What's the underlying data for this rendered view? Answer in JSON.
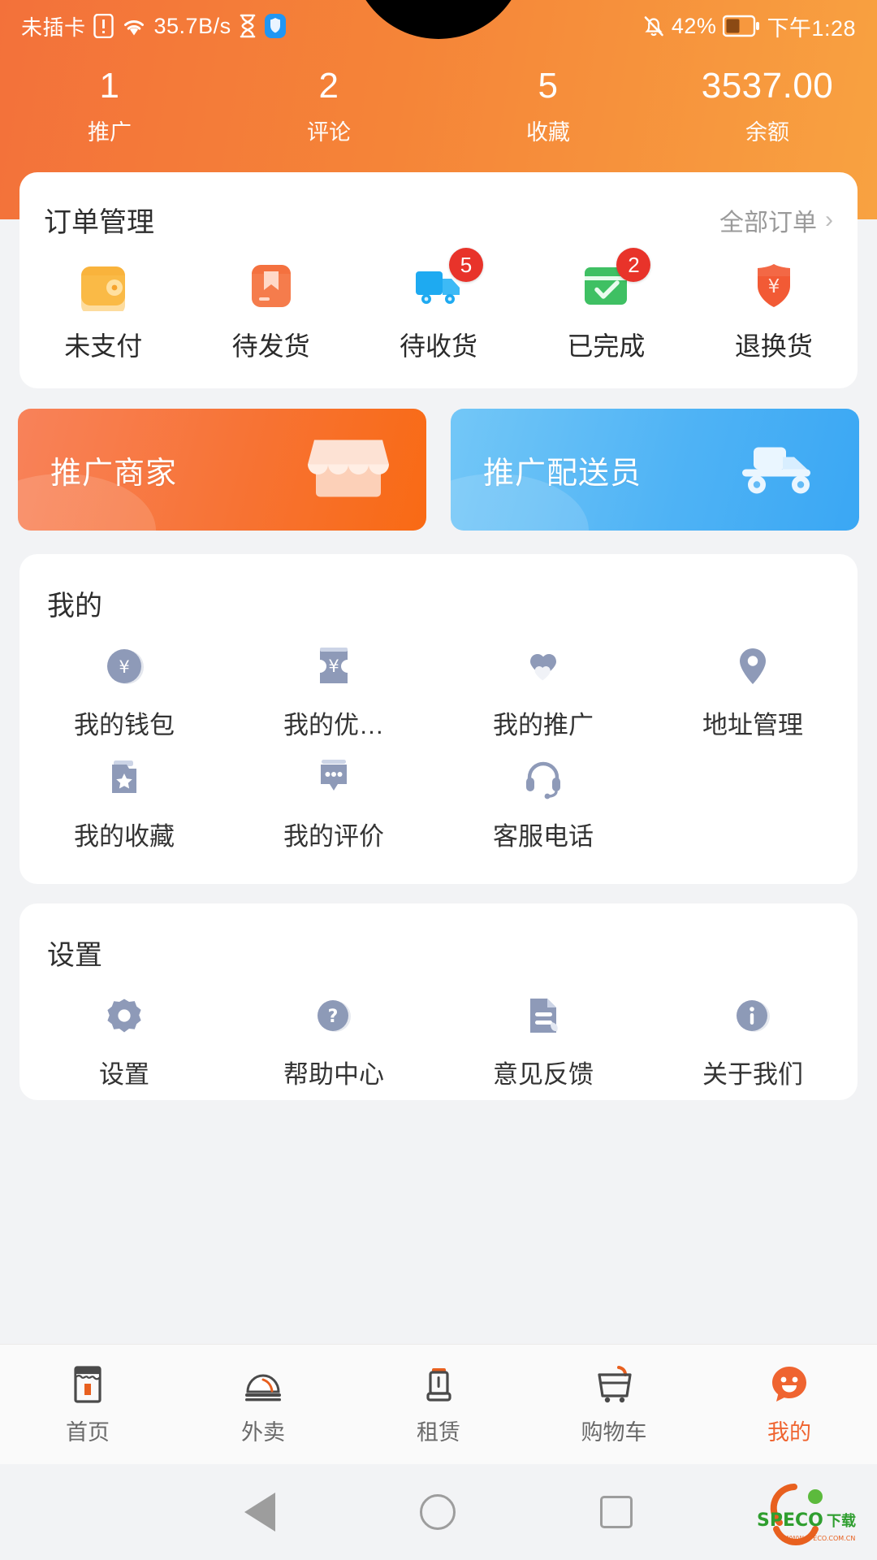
{
  "statusbar": {
    "no_sim": "未插卡",
    "network_speed": "35.7B/s",
    "battery_percent": "42%",
    "time": "下午1:28",
    "icons": [
      "sim-alert-icon",
      "wifi-icon",
      "hourglass-icon",
      "shield-icon",
      "mute-bell-icon",
      "battery-icon"
    ]
  },
  "stats": [
    {
      "value": "1",
      "label": "推广"
    },
    {
      "value": "2",
      "label": "评论"
    },
    {
      "value": "5",
      "label": "收藏"
    },
    {
      "value": "3537.00",
      "label": "余额"
    }
  ],
  "order": {
    "title": "订单管理",
    "all_orders": "全部订单",
    "chevron": "›",
    "items": [
      {
        "label": "未支付",
        "icon": "wallet-icon",
        "badge": ""
      },
      {
        "label": "待发货",
        "icon": "package-icon",
        "badge": ""
      },
      {
        "label": "待收货",
        "icon": "truck-icon",
        "badge": "5"
      },
      {
        "label": "已完成",
        "icon": "check-box-icon",
        "badge": "2"
      },
      {
        "label": "退换货",
        "icon": "refund-shield-icon",
        "badge": ""
      }
    ]
  },
  "banners": [
    {
      "title": "推广商家",
      "icon": "shop-icon",
      "color": "#f96a14"
    },
    {
      "title": "推广配送员",
      "icon": "scooter-icon",
      "color": "#3aa7f4"
    }
  ],
  "mine": {
    "title": "我的",
    "items": [
      {
        "label": "我的钱包",
        "icon": "yen-circle-icon"
      },
      {
        "label": "我的优…",
        "icon": "coupon-icon"
      },
      {
        "label": "我的推广",
        "icon": "hearts-icon"
      },
      {
        "label": "地址管理",
        "icon": "location-pin-icon"
      },
      {
        "label": "我的收藏",
        "icon": "folder-star-icon"
      },
      {
        "label": "我的评价",
        "icon": "comment-dots-icon"
      },
      {
        "label": "客服电话",
        "icon": "headset-icon"
      }
    ]
  },
  "settings": {
    "title": "设置",
    "items": [
      {
        "label": "设置",
        "icon": "gear-icon"
      },
      {
        "label": "帮助中心",
        "icon": "question-circle-icon"
      },
      {
        "label": "意见反馈",
        "icon": "feedback-doc-icon"
      },
      {
        "label": "关于我们",
        "icon": "info-circle-icon"
      }
    ]
  },
  "tabbar": {
    "active_index": 4,
    "items": [
      {
        "label": "首页",
        "icon": "store-icon"
      },
      {
        "label": "外卖",
        "icon": "food-dome-icon"
      },
      {
        "label": "租赁",
        "icon": "rental-icon"
      },
      {
        "label": "购物车",
        "icon": "cart-icon"
      },
      {
        "label": "我的",
        "icon": "smiley-face-icon"
      }
    ]
  },
  "navbar": {
    "icons": [
      "back-triangle-icon",
      "home-circle-icon",
      "recents-square-icon"
    ]
  },
  "watermark": {
    "text": "SPECO下载",
    "sub": "WWW.SPECO.COM.CN"
  },
  "colors": {
    "accent": "#ef6430",
    "badge": "#e8332a",
    "icon_grey": "#8e9ab8"
  }
}
